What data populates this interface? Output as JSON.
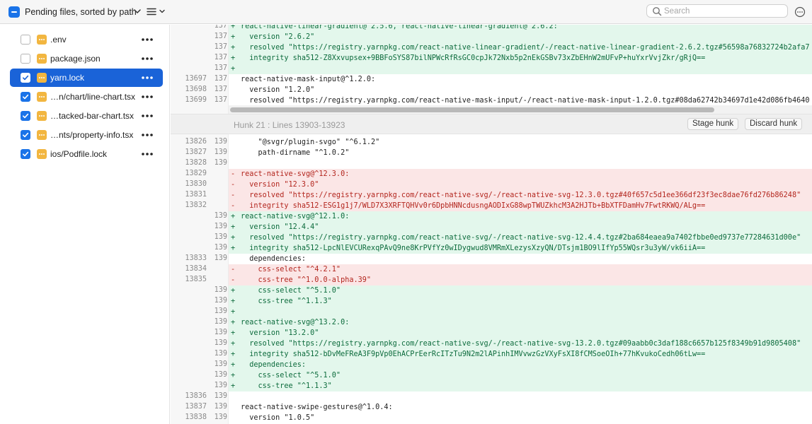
{
  "toolbar": {
    "title": "Pending files, sorted by path",
    "search_placeholder": "Search"
  },
  "sidebar": {
    "files": [
      {
        "name": ".env",
        "checked": false,
        "selected": false
      },
      {
        "name": "package.json",
        "checked": false,
        "selected": false
      },
      {
        "name": "yarn.lock",
        "checked": true,
        "selected": true
      },
      {
        "name": "…n/chart/line-chart.tsx",
        "checked": true,
        "selected": false
      },
      {
        "name": "…tacked-bar-chart.tsx",
        "checked": true,
        "selected": false
      },
      {
        "name": "…nts/property-info.tsx",
        "checked": true,
        "selected": false
      },
      {
        "name": "ios/Podfile.lock",
        "checked": true,
        "selected": false
      }
    ]
  },
  "diff": {
    "top_lines": [
      {
        "type": "add",
        "old": "",
        "new": "137",
        "text": "react-native-linear-gradient@^2.5.6, react-native-linear-gradient@^2.6.2:"
      },
      {
        "type": "add",
        "old": "",
        "new": "137",
        "text": "  version \"2.6.2\""
      },
      {
        "type": "add",
        "old": "",
        "new": "137",
        "text": "  resolved \"https://registry.yarnpkg.com/react-native-linear-gradient/-/react-native-linear-gradient-2.6.2.tgz#56598a76832724b2afa7"
      },
      {
        "type": "add",
        "old": "",
        "new": "137",
        "text": "  integrity sha512-Z8Xxvupsex+9BBFoSYS87bilNPWcRfRsGC0cpJk72Nxb5p2nEkGSBv73xZbEHnW2mUFvP+huYxrVvjZkr/gRjQ=="
      },
      {
        "type": "add",
        "old": "",
        "new": "137",
        "text": ""
      },
      {
        "type": "ctx",
        "old": "13697",
        "new": "137",
        "text": "react-native-mask-input@^1.2.0:"
      },
      {
        "type": "ctx",
        "old": "13698",
        "new": "137",
        "text": "  version \"1.2.0\""
      },
      {
        "type": "ctx",
        "old": "13699",
        "new": "137",
        "text": "  resolved \"https://registry.yarnpkg.com/react-native-mask-input/-/react-native-mask-input-1.2.0.tgz#08da62742b34697d1e42d086fb4640"
      }
    ],
    "hunk": {
      "title": "Hunk 21 : Lines 13903-13923",
      "stage_label": "Stage hunk",
      "discard_label": "Discard hunk"
    },
    "bottom_lines": [
      {
        "type": "ctx",
        "old": "13826",
        "new": "139",
        "text": "    \"@svgr/plugin-svgo\" \"^6.1.2\""
      },
      {
        "type": "ctx",
        "old": "13827",
        "new": "139",
        "text": "    path-dirname \"^1.0.2\""
      },
      {
        "type": "ctx",
        "old": "13828",
        "new": "139",
        "text": ""
      },
      {
        "type": "del",
        "old": "13829",
        "new": "",
        "text": "react-native-svg@^12.3.0:"
      },
      {
        "type": "del",
        "old": "13830",
        "new": "",
        "text": "  version \"12.3.0\""
      },
      {
        "type": "del",
        "old": "13831",
        "new": "",
        "text": "  resolved \"https://registry.yarnpkg.com/react-native-svg/-/react-native-svg-12.3.0.tgz#40f657c5d1ee366df23f3ec8dae76fd276b86248\""
      },
      {
        "type": "del",
        "old": "13832",
        "new": "",
        "text": "  integrity sha512-ESG1g1j7/WLD7X3XRFTQHVv0r6DpbHNNcdusngAODIxG88wpTWUZkhcM3A2HJTb+BbXTFDamHv7FwtRKWQ/ALg=="
      },
      {
        "type": "add",
        "old": "",
        "new": "139",
        "text": "react-native-svg@^12.1.0:"
      },
      {
        "type": "add",
        "old": "",
        "new": "139",
        "text": "  version \"12.4.4\""
      },
      {
        "type": "add",
        "old": "",
        "new": "139",
        "text": "  resolved \"https://registry.yarnpkg.com/react-native-svg/-/react-native-svg-12.4.4.tgz#2ba684eaea9a7402fbbe0ed9737e77284631d00e\""
      },
      {
        "type": "add",
        "old": "",
        "new": "139",
        "text": "  integrity sha512-LpcNlEVCURexqPAvQ9ne8KrPVfYz0wIDygwud8VMRmXLezysXzyQN/DTsjm1BO9lIfYp55WQsr3u3yW/vk6iiA=="
      },
      {
        "type": "ctx",
        "old": "13833",
        "new": "139",
        "text": "  dependencies:"
      },
      {
        "type": "del",
        "old": "13834",
        "new": "",
        "text": "    css-select \"^4.2.1\""
      },
      {
        "type": "del",
        "old": "13835",
        "new": "",
        "text": "    css-tree \"^1.0.0-alpha.39\""
      },
      {
        "type": "add",
        "old": "",
        "new": "139",
        "text": "    css-select \"^5.1.0\""
      },
      {
        "type": "add",
        "old": "",
        "new": "139",
        "text": "    css-tree \"^1.1.3\""
      },
      {
        "type": "add",
        "old": "",
        "new": "139",
        "text": ""
      },
      {
        "type": "add",
        "old": "",
        "new": "139",
        "text": "react-native-svg@^13.2.0:"
      },
      {
        "type": "add",
        "old": "",
        "new": "139",
        "text": "  version \"13.2.0\""
      },
      {
        "type": "add",
        "old": "",
        "new": "139",
        "text": "  resolved \"https://registry.yarnpkg.com/react-native-svg/-/react-native-svg-13.2.0.tgz#09aabb0c3daf188c6657b125f8349b91d9805408\""
      },
      {
        "type": "add",
        "old": "",
        "new": "139",
        "text": "  integrity sha512-bDvMeFReA3F9pVp0EhACPrEerRcITzTu9N2m2lAPinhIMVvwzGzVXyFsXI8fCMSoeOIh+77hKvukoCedh06tLw=="
      },
      {
        "type": "add",
        "old": "",
        "new": "139",
        "text": "  dependencies:"
      },
      {
        "type": "add",
        "old": "",
        "new": "139",
        "text": "    css-select \"^5.1.0\""
      },
      {
        "type": "add",
        "old": "",
        "new": "139",
        "text": "    css-tree \"^1.1.3\""
      },
      {
        "type": "ctx",
        "old": "13836",
        "new": "139",
        "text": ""
      },
      {
        "type": "ctx",
        "old": "13837",
        "new": "139",
        "text": "react-native-swipe-gestures@^1.0.4:"
      },
      {
        "type": "ctx",
        "old": "13838",
        "new": "139",
        "text": "  version \"1.0.5\""
      }
    ]
  },
  "colors": {
    "accent": "#1a73e8",
    "selected_row": "#1a63d8",
    "add_bg": "#e3f7ec",
    "del_bg": "#fbe6e6"
  }
}
